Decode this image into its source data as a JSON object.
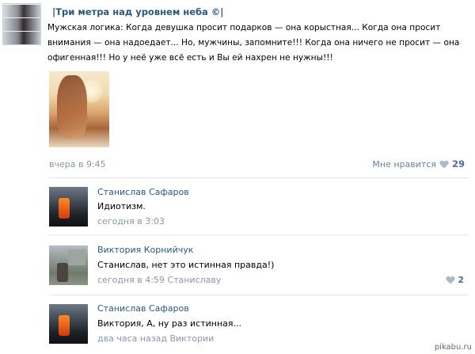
{
  "post": {
    "author": "|Три метра над уровнем неба ©|",
    "text": "Мужская логика: Когда девушка просит подарков — она корыстная... Когда она просит внимания — она надоедает... Но, мужчины, запомните!!! Когда она ничего не просит — она офигенная!!! Но у неё уже всё есть и Вы ей нахрен не нужны!!!",
    "date": "вчера в 9:45",
    "like_label": "Мне нравится",
    "like_count": "29",
    "icon": "heart-icon"
  },
  "comments": [
    {
      "author": "Станислав Сафаров",
      "text": "Идиотизм.",
      "date": "сегодня в 3:03",
      "like_count": ""
    },
    {
      "author": "Виктория Корнийчук",
      "text": "Станислав, нет это истинная правда!)",
      "date": "сегодня в 4:59 Станиславу",
      "like_count": "2"
    },
    {
      "author": "Станислав Сафаров",
      "text": "Виктория, А, ну раз истинная...",
      "date": "два часа назад Виктории",
      "like_count": ""
    }
  ],
  "watermark": "pikabu.ru",
  "colors": {
    "link": "#2b587a",
    "meta": "#8a96a6",
    "divider": "#e1e7ed"
  }
}
